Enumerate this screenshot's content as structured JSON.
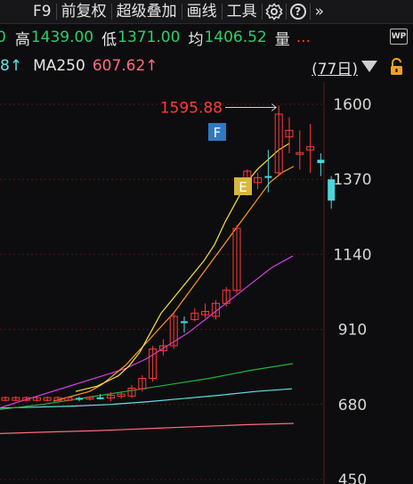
{
  "toolbar": {
    "items": [
      "F9",
      "前复权",
      "超级叠加",
      "画线",
      "工具"
    ],
    "gear_icon": "gear-icon",
    "help_label": "?",
    "more_label": "»"
  },
  "quote": {
    "high_label": "高",
    "high_value": "1439.00",
    "low_label": "低",
    "low_value": "1371.00",
    "avg_label": "均",
    "avg_value": "1406.52",
    "vol_label": "量",
    "vol_value": "...",
    "wp_label": "WP"
  },
  "ma_row": {
    "prev_tail": "8↑",
    "ma250_label": "MA250",
    "ma250_value": "607.62↑",
    "period_label": "(77日)"
  },
  "chart_data": {
    "type": "candlestick",
    "y_ticks": [
      "1600",
      "1370",
      "1140",
      "910",
      "680",
      "450"
    ],
    "max_label": "1595.88",
    "markers": [
      "F",
      "E"
    ],
    "colors": {
      "up": "#ff3a3a",
      "down": "#4ad7dc",
      "flat": "#4ad7dc",
      "ma5": "#ffffff",
      "ma10": "#f5e63c",
      "ma20": "#ff9a1f",
      "ma30": "#d93ce8",
      "ma60": "#21b33a",
      "ma120": "#63e0e8",
      "ma250": "#ff6b7f"
    },
    "candles": [
      {
        "o": 700,
        "h": 704,
        "l": 690,
        "c": 698
      },
      {
        "o": 698,
        "h": 706,
        "l": 692,
        "c": 702
      },
      {
        "o": 702,
        "h": 712,
        "l": 695,
        "c": 700
      },
      {
        "o": 700,
        "h": 718,
        "l": 690,
        "c": 708
      },
      {
        "o": 705,
        "h": 720,
        "l": 698,
        "c": 712
      },
      {
        "o": 706,
        "h": 740,
        "l": 700,
        "c": 730
      },
      {
        "o": 728,
        "h": 770,
        "l": 720,
        "c": 760
      },
      {
        "o": 760,
        "h": 860,
        "l": 750,
        "c": 850
      },
      {
        "o": 845,
        "h": 880,
        "l": 830,
        "c": 860
      },
      {
        "o": 860,
        "h": 960,
        "l": 850,
        "c": 950
      },
      {
        "o": 935,
        "h": 950,
        "l": 900,
        "c": 930
      },
      {
        "o": 940,
        "h": 975,
        "l": 935,
        "c": 960
      },
      {
        "o": 955,
        "h": 990,
        "l": 945,
        "c": 965
      },
      {
        "o": 950,
        "h": 1000,
        "l": 940,
        "c": 990
      },
      {
        "o": 990,
        "h": 1040,
        "l": 980,
        "c": 1030
      },
      {
        "o": 1030,
        "h": 1230,
        "l": 1020,
        "c": 1220
      },
      {
        "o": 1330,
        "h": 1400,
        "l": 1320,
        "c": 1395
      },
      {
        "o": 1360,
        "h": 1390,
        "l": 1340,
        "c": 1375
      },
      {
        "o": 1380,
        "h": 1460,
        "l": 1330,
        "c": 1380
      },
      {
        "o": 1390,
        "h": 1595.88,
        "l": 1380,
        "c": 1570
      },
      {
        "o": 1500,
        "h": 1560,
        "l": 1450,
        "c": 1520
      },
      {
        "o": 1450,
        "h": 1520,
        "l": 1400,
        "c": 1452
      },
      {
        "o": 1460,
        "h": 1540,
        "l": 1390,
        "c": 1470
      },
      {
        "o": 1430,
        "h": 1450,
        "l": 1380,
        "c": 1420
      },
      {
        "o": 1370,
        "h": 1380,
        "l": 1280,
        "c": 1305
      }
    ],
    "ma10": [
      720,
      728,
      736,
      752,
      768,
      798,
      840,
      900,
      960,
      1000,
      1040,
      1080,
      1120,
      1170,
      1240,
      1300,
      1360,
      1400,
      1430,
      1460,
      1480
    ],
    "ma20": [
      690,
      700,
      710,
      720,
      740,
      770,
      800,
      840,
      880,
      920,
      960,
      1010,
      1060,
      1110,
      1160,
      1210,
      1260,
      1310,
      1360,
      1390,
      1410
    ],
    "ma30": [
      670,
      690,
      710,
      730,
      750,
      770,
      790,
      820,
      860,
      900,
      950,
      1000,
      1050,
      1100,
      1135
    ],
    "ma60": [
      665,
      680,
      700,
      720,
      740,
      760,
      785,
      805
    ],
    "ma120": [
      669,
      672,
      675,
      680,
      688,
      698,
      708,
      720,
      728
    ],
    "ma250": [
      591,
      596,
      600,
      606,
      612,
      618,
      622
    ]
  }
}
